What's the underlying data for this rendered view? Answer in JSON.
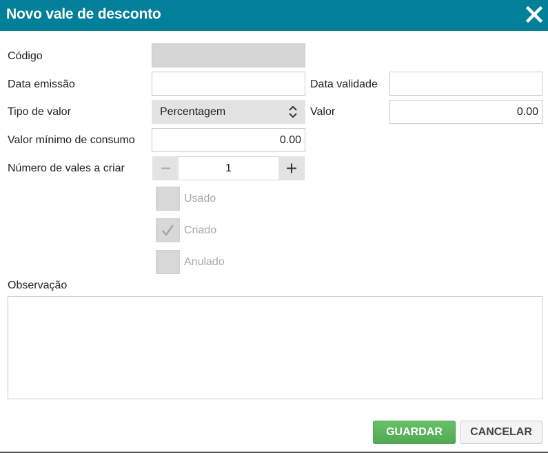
{
  "dialog": {
    "title": "Novo vale de desconto",
    "header_color": "#027f99",
    "close_icon": "close-icon"
  },
  "form": {
    "codigo": {
      "label": "Código",
      "value": ""
    },
    "data_emissao": {
      "label": "Data emissão",
      "value": ""
    },
    "data_validade": {
      "label": "Data validade",
      "value": ""
    },
    "tipo_valor": {
      "label": "Tipo de valor",
      "selected": "Percentagem"
    },
    "valor": {
      "label": "Valor",
      "value": "0.00"
    },
    "valor_minimo": {
      "label": "Valor mínimo de consumo",
      "value": "0.00"
    },
    "numero_vales": {
      "label": "Número de vales a criar",
      "value": "1"
    },
    "estado": {
      "usado": {
        "label": "Usado",
        "checked": false
      },
      "criado": {
        "label": "Criado",
        "checked": true
      },
      "anulado": {
        "label": "Anulado",
        "checked": false
      }
    },
    "observacao": {
      "label": "Observação",
      "value": ""
    }
  },
  "actions": {
    "save_label": "GUARDAR",
    "cancel_label": "CANCELAR",
    "save_color": "#5cb55e"
  }
}
